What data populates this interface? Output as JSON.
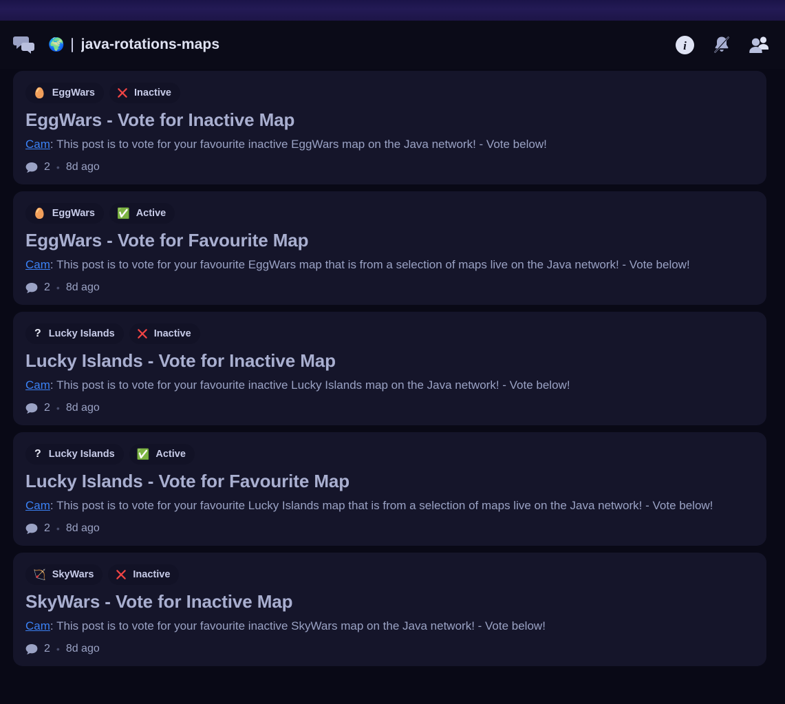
{
  "top_strip": {
    "color": "#231a55"
  },
  "header": {
    "logo_icon": "speech-bubbles-icon",
    "globe_emoji": "🌍",
    "title": "java-rotations-maps",
    "actions": [
      {
        "name": "info-icon",
        "label": "Info"
      },
      {
        "name": "bell-muted-icon",
        "label": "Notifications muted"
      },
      {
        "name": "members-icon",
        "label": "Members"
      }
    ]
  },
  "colors": {
    "page_bg": "#090916",
    "card_bg": "#15152a",
    "pill_bg": "#121226",
    "title": "#a9afd0",
    "body": "#9aa2c4",
    "link": "#3b82f6",
    "inactive": "#ef4444",
    "active": "#58a445"
  },
  "feed": {
    "posts": [
      {
        "game_emoji": "🥚",
        "game_label": "EggWars",
        "status_label": "Inactive",
        "status_type": "inactive",
        "title": "EggWars - Vote for Inactive Map",
        "author": "Cam",
        "body": "This post is to vote for your favourite inactive EggWars map on the Java network! - Vote below!",
        "comment_count": "2",
        "time_ago": "8d ago"
      },
      {
        "game_emoji": "🥚",
        "game_label": "EggWars",
        "status_label": "Active",
        "status_type": "active",
        "title": "EggWars - Vote for Favourite Map",
        "author": "Cam",
        "body": "This post is to vote for your favourite EggWars map that is from a selection of maps live on the Java network! - Vote below!",
        "comment_count": "2",
        "time_ago": "8d ago"
      },
      {
        "game_emoji": "?",
        "game_label": "Lucky Islands",
        "status_label": "Inactive",
        "status_type": "inactive",
        "title": "Lucky Islands - Vote for Inactive Map",
        "author": "Cam",
        "body": "This post is to vote for your favourite inactive Lucky Islands map on the Java network! - Vote below!",
        "comment_count": "2",
        "time_ago": "8d ago"
      },
      {
        "game_emoji": "?",
        "game_label": "Lucky Islands",
        "status_label": "Active",
        "status_type": "active",
        "title": "Lucky Islands - Vote for Favourite Map",
        "author": "Cam",
        "body": "This post is to vote for your favourite Lucky Islands map that is from a selection of maps live on the Java network! - Vote below!",
        "comment_count": "2",
        "time_ago": "8d ago"
      },
      {
        "game_emoji": "🏹",
        "game_label": "SkyWars",
        "status_label": "Inactive",
        "status_type": "inactive",
        "title": "SkyWars - Vote for Inactive Map",
        "author": "Cam",
        "body": "This post is to vote for your favourite inactive SkyWars map on the Java network! - Vote below!",
        "comment_count": "2",
        "time_ago": "8d ago"
      }
    ]
  }
}
